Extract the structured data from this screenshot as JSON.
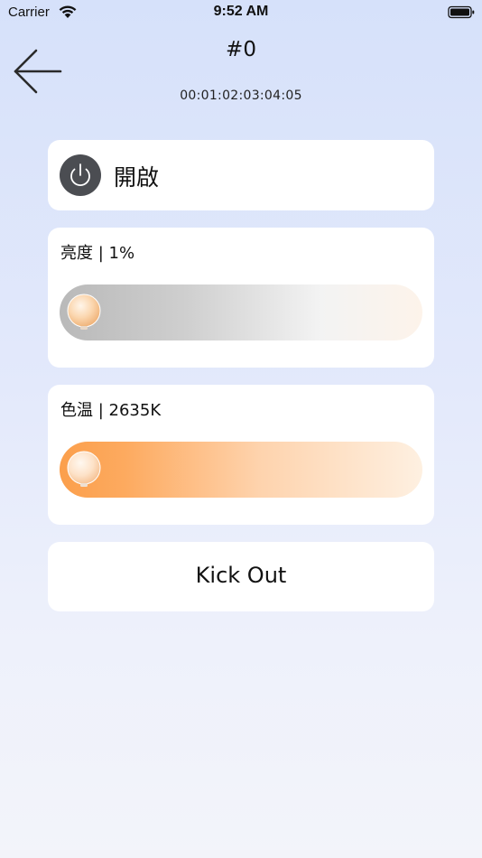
{
  "status_bar": {
    "carrier": "Carrier",
    "time": "9:52 AM",
    "wifi_icon": "wifi-icon",
    "battery_icon": "battery-full-icon"
  },
  "header": {
    "back_icon": "arrow-left-icon",
    "title": "#0",
    "device_id": "00:01:02:03:04:05"
  },
  "power": {
    "icon": "power-icon",
    "label": "開啟",
    "icon_color": "#4b4d52"
  },
  "brightness": {
    "label": "亮度 | 1%",
    "value_percent": 1
  },
  "color_temperature": {
    "label": "色温 | 2635K",
    "value_kelvin": 2635,
    "accent_color": "#fb9f4c"
  },
  "kick_out": {
    "label": "Kick Out"
  }
}
